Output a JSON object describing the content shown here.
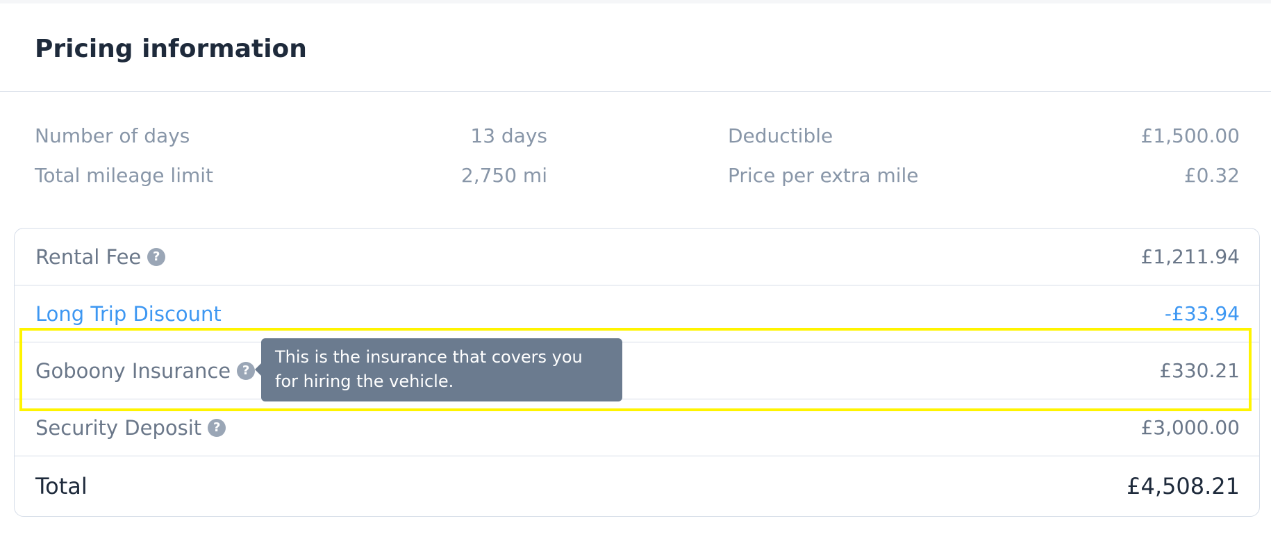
{
  "header": {
    "title": "Pricing information"
  },
  "summary": {
    "days_label": "Number of days",
    "days_value": "13 days",
    "mileage_label": "Total mileage limit",
    "mileage_value": "2,750 mi",
    "deductible_label": "Deductible",
    "deductible_value": "£1,500.00",
    "extra_mile_label": "Price per extra mile",
    "extra_mile_value": "£0.32"
  },
  "breakdown": {
    "rental_fee_label": "Rental Fee",
    "rental_fee_amount": "£1,211.94",
    "discount_label": "Long Trip Discount",
    "discount_amount": "-£33.94",
    "insurance_label": "Goboony Insurance",
    "insurance_amount": "£330.21",
    "deposit_label": "Security Deposit",
    "deposit_amount": "£3,000.00",
    "total_label": "Total",
    "total_amount": "£4,508.21"
  },
  "tooltip": {
    "text": "This is the insurance that covers you for hiring the vehicle."
  },
  "icons": {
    "help_glyph": "?"
  },
  "colors": {
    "discount": "#3d97f2",
    "highlight": "#fff400",
    "tooltip_bg": "#6b7b8f"
  }
}
